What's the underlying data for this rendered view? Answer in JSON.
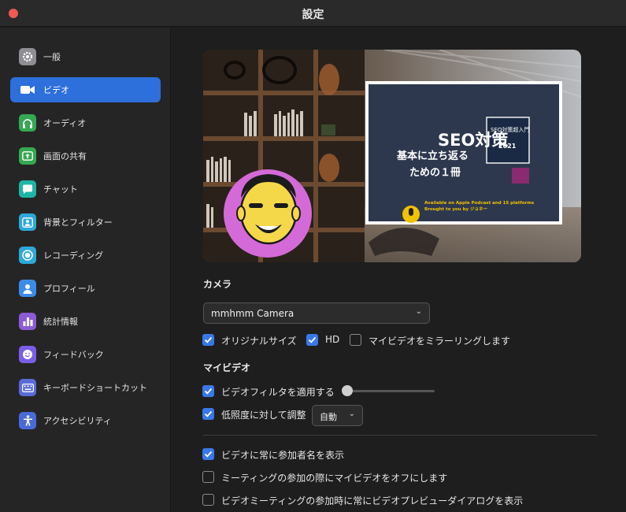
{
  "window": {
    "title": "設定"
  },
  "colors": {
    "accent": "#2d6fdb",
    "checkbox": "#3b78e7",
    "background": "#1e1e1e",
    "sidebar": "#252525"
  },
  "sidebar": {
    "items": [
      {
        "label": "一般",
        "icon": "gear-icon",
        "color": "#8e8e93",
        "active": false
      },
      {
        "label": "ビデオ",
        "icon": "video-camera-icon",
        "color": "#2d6fdb",
        "active": true
      },
      {
        "label": "オーディオ",
        "icon": "headphones-icon",
        "color": "#34a853",
        "active": false
      },
      {
        "label": "画面の共有",
        "icon": "share-screen-icon",
        "color": "#34a853",
        "active": false
      },
      {
        "label": "チャット",
        "icon": "chat-bubble-icon",
        "color": "#1fb5a5",
        "active": false
      },
      {
        "label": "背景とフィルター",
        "icon": "background-person-icon",
        "color": "#2ea8d8",
        "active": false
      },
      {
        "label": "レコーディング",
        "icon": "record-icon",
        "color": "#2ea8d8",
        "active": false
      },
      {
        "label": "プロフィール",
        "icon": "profile-person-icon",
        "color": "#3d8be8",
        "active": false
      },
      {
        "label": "統計情報",
        "icon": "statistics-bar-icon",
        "color": "#8c5bd6",
        "active": false
      },
      {
        "label": "フィードバック",
        "icon": "smiley-feedback-icon",
        "color": "#7b5ee8",
        "active": false
      },
      {
        "label": "キーボードショートカット",
        "icon": "keyboard-icon",
        "color": "#5a6bd8",
        "active": false
      },
      {
        "label": "アクセシビリティ",
        "icon": "accessibility-person-icon",
        "color": "#4a6ad8",
        "active": false
      }
    ]
  },
  "preview": {
    "headline": "SEO対策",
    "subline1": "基本に立ち返る",
    "subline2": "ための１冊",
    "book_title": "SEO対策超入門",
    "book_year": "2021",
    "podcast_line1": "Available on Apple Podcast and 15 platforms",
    "podcast_line2": "Brought to you by ジョネー"
  },
  "camera": {
    "section_title": "カメラ",
    "selected": "mmhmm Camera",
    "chevron": "⌄",
    "options": [
      {
        "label": "オリジナルサイズ",
        "checked": true
      },
      {
        "label": "HD",
        "checked": true
      },
      {
        "label": "マイビデオをミラーリングします",
        "checked": false
      }
    ]
  },
  "my_video": {
    "section_title": "マイビデオ",
    "filter_label": "ビデオフィルタを適用する",
    "filter_checked": true,
    "filter_level": 0.0,
    "low_light_label": "低照度に対して調整",
    "low_light_checked": true,
    "low_light_value": "自動"
  },
  "general_options": [
    {
      "label": "ビデオに常に参加者名を表示",
      "checked": true
    },
    {
      "label": "ミーティングの参加の際にマイビデオをオフにします",
      "checked": false
    },
    {
      "label": "ビデオミーティングの参加時に常にビデオプレビューダイアログを表示",
      "checked": false
    }
  ]
}
